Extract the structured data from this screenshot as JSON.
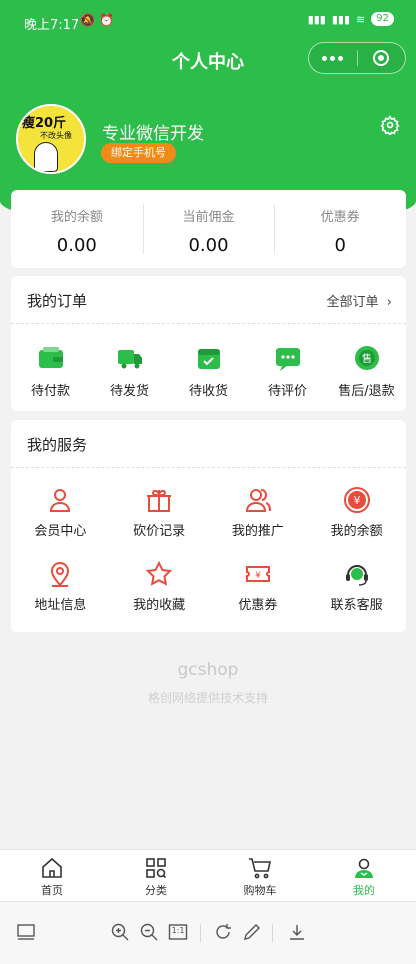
{
  "status_bar": {
    "time": "晚上7:17",
    "battery": "92"
  },
  "navbar": {
    "title": "个人中心"
  },
  "profile": {
    "avatar_text_main": "瘦20斤",
    "avatar_text_sub": "不改头像",
    "nickname": "专业微信开发",
    "bind_phone_label": "绑定手机号"
  },
  "stats": [
    {
      "label": "我的余额",
      "value": "0.00"
    },
    {
      "label": "当前佣金",
      "value": "0.00"
    },
    {
      "label": "优惠券",
      "value": "0"
    }
  ],
  "orders": {
    "title": "我的订单",
    "all_label": "全部订单",
    "items": [
      {
        "label": "待付款",
        "icon": "wallet-icon"
      },
      {
        "label": "待发货",
        "icon": "truck-icon"
      },
      {
        "label": "待收货",
        "icon": "package-icon"
      },
      {
        "label": "待评价",
        "icon": "comment-icon"
      },
      {
        "label": "售后/退款",
        "icon": "after-sale-icon"
      }
    ]
  },
  "services": {
    "title": "我的服务",
    "items": [
      {
        "label": "会员中心",
        "icon": "user-icon"
      },
      {
        "label": "砍价记录",
        "icon": "gift-icon"
      },
      {
        "label": "我的推广",
        "icon": "users-icon"
      },
      {
        "label": "我的余额",
        "icon": "yen-coin-icon"
      },
      {
        "label": "地址信息",
        "icon": "location-pin-icon"
      },
      {
        "label": "我的收藏",
        "icon": "star-icon"
      },
      {
        "label": "优惠券",
        "icon": "coupon-icon"
      },
      {
        "label": "联系客服",
        "icon": "headset-icon"
      }
    ]
  },
  "footer": {
    "brand": "gcshop",
    "support": "格创网络提供技术支持"
  },
  "tabbar": [
    {
      "label": "首页",
      "icon": "home-icon"
    },
    {
      "label": "分类",
      "icon": "category-icon"
    },
    {
      "label": "购物车",
      "icon": "cart-icon"
    },
    {
      "label": "我的",
      "icon": "profile-icon",
      "active": true
    }
  ],
  "bottom_toolbar": {
    "zoom_reset_label": "1:1"
  },
  "colors": {
    "brand_green": "#2dbd4a",
    "service_red": "#e94b3c",
    "badge_orange": "#f28a19"
  }
}
